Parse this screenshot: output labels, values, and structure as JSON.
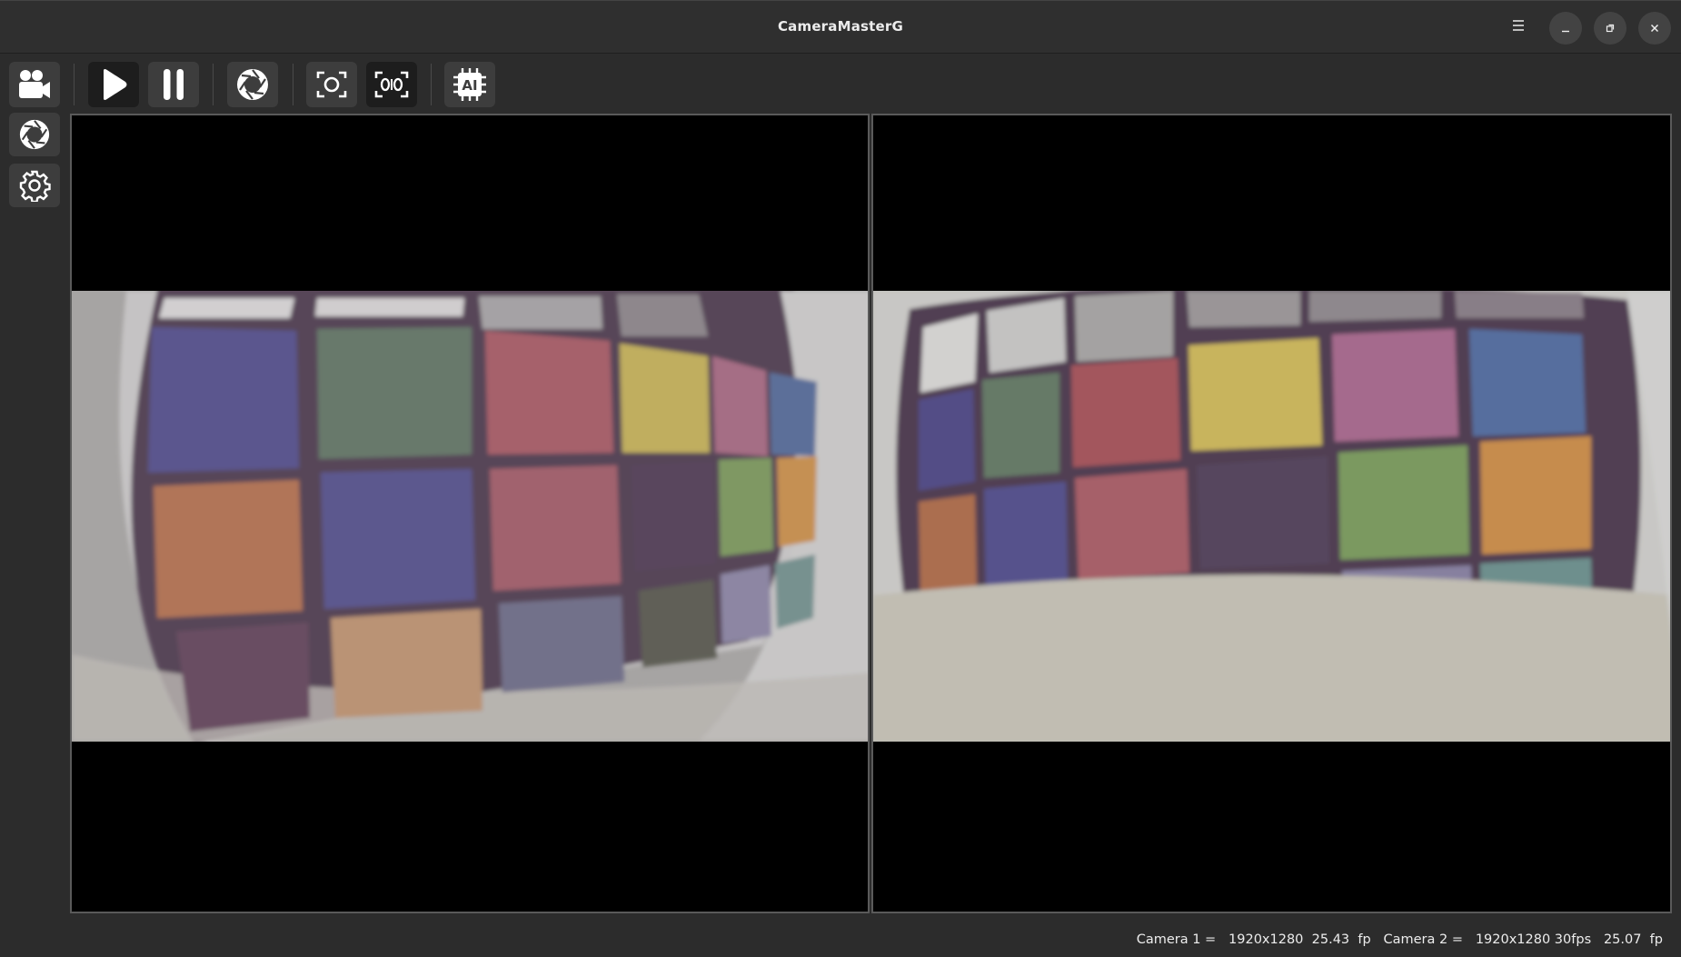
{
  "window": {
    "title": "CameraMasterG",
    "controls": [
      "menu-icon",
      "minimize-icon",
      "maximize-icon",
      "close-icon"
    ]
  },
  "toolbar": {
    "buttons": [
      {
        "name": "camera-mode",
        "icon": "video-camera-icon",
        "active": true
      },
      {
        "name": "play",
        "icon": "play-icon"
      },
      {
        "name": "pause",
        "icon": "pause-icon"
      },
      {
        "name": "snapshot",
        "icon": "aperture-icon"
      },
      {
        "name": "focus",
        "icon": "focus-icon"
      },
      {
        "name": "multi-focus",
        "icon": "multi-focus-icon"
      },
      {
        "name": "ai",
        "icon": "ai-chip-icon",
        "label": "AI"
      }
    ]
  },
  "sidebar": {
    "items": [
      {
        "name": "capture",
        "icon": "aperture-icon"
      },
      {
        "name": "settings",
        "icon": "gear-icon"
      }
    ]
  },
  "views": [
    {
      "name": "camera-1-view"
    },
    {
      "name": "camera-2-view"
    }
  ],
  "status": {
    "text": "Camera 1 =   1920x1280  25.43  fp   Camera 2 =   1920x1280 30fps   25.07  fp"
  },
  "colors": {
    "background": "#2c2c2c",
    "video_bg": "#000000",
    "border": "#5a5a5a"
  }
}
